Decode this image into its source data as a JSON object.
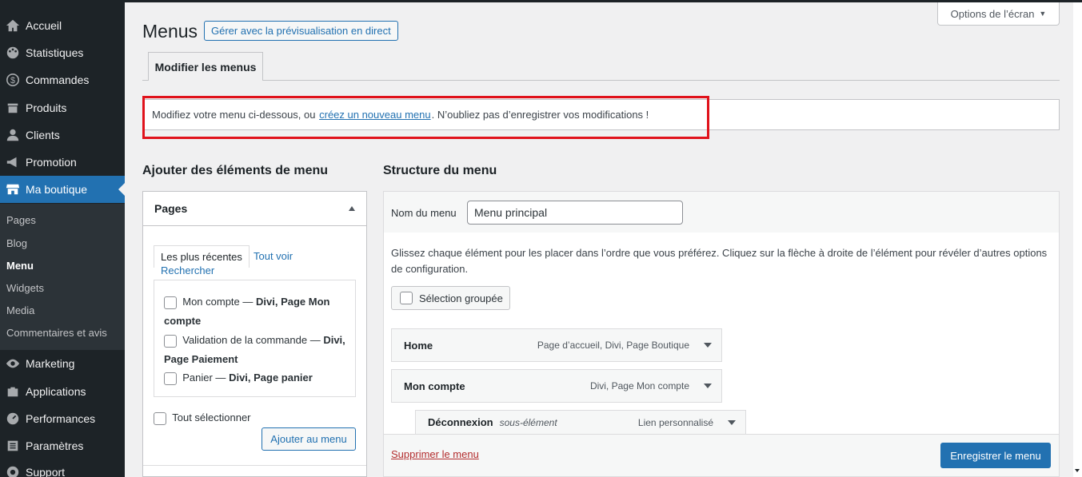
{
  "sidebar": {
    "items": [
      {
        "label": "Accueil",
        "icon": "home-icon"
      },
      {
        "label": "Statistiques",
        "icon": "palette-icon"
      },
      {
        "label": "Commandes",
        "icon": "dollar-icon"
      },
      {
        "label": "Produits",
        "icon": "archive-icon"
      },
      {
        "label": "Clients",
        "icon": "user-icon"
      },
      {
        "label": "Promotion",
        "icon": "megaphone-icon"
      },
      {
        "label": "Ma boutique",
        "icon": "store-icon"
      },
      {
        "label": "Marketing",
        "icon": "eye-icon"
      },
      {
        "label": "Applications",
        "icon": "briefcase-icon"
      },
      {
        "label": "Performances",
        "icon": "gauge-icon"
      },
      {
        "label": "Paramètres",
        "icon": "settings-icon"
      },
      {
        "label": "Support",
        "icon": "support-icon"
      }
    ],
    "submenu": [
      "Pages",
      "Blog",
      "Menu",
      "Widgets",
      "Media",
      "Commentaires et avis"
    ]
  },
  "header": {
    "title": "Menus",
    "live_preview_button": "Gérer avec la prévisualisation en direct",
    "screen_options": "Options de l’écran",
    "tab": "Modifier les menus"
  },
  "notice": {
    "before": "Modifiez votre menu ci-dessous, ou",
    "link": "créez un nouveau menu",
    "after": ". N’oubliez pas d’enregistrer vos modifications !"
  },
  "add_items": {
    "heading": "Ajouter des éléments de menu",
    "panel_title": "Pages",
    "tabs": [
      "Les plus récentes",
      "Tout voir",
      "Rechercher"
    ],
    "pages": [
      {
        "name": "Mon compte —",
        "meta": "Divi, Page Mon compte"
      },
      {
        "name": "Validation de la commande —",
        "meta": "Divi, Page Paiement"
      },
      {
        "name": "Panier —",
        "meta": "Divi, Page panier"
      }
    ],
    "select_all": "Tout sélectionner",
    "add_button": "Ajouter au menu"
  },
  "structure": {
    "heading": "Structure du menu",
    "menu_name_label": "Nom du menu",
    "menu_name_value": "Menu principal",
    "description": "Glissez chaque élément pour les placer dans l’ordre que vous préférez. Cliquez sur la flèche à droite de l’élément pour révéler d’autres options de configuration.",
    "bulk_select": "Sélection groupée",
    "items": [
      {
        "title": "Home",
        "sub": "",
        "type": "Page d’accueil, Divi, Page Boutique"
      },
      {
        "title": "Mon compte",
        "sub": "",
        "type": "Divi, Page Mon compte"
      },
      {
        "title": "Déconnexion",
        "sub": "sous-élément",
        "type": "Lien personnalisé"
      }
    ],
    "delete_link": "Supprimer le menu",
    "save_button": "Enregistrer le menu"
  }
}
